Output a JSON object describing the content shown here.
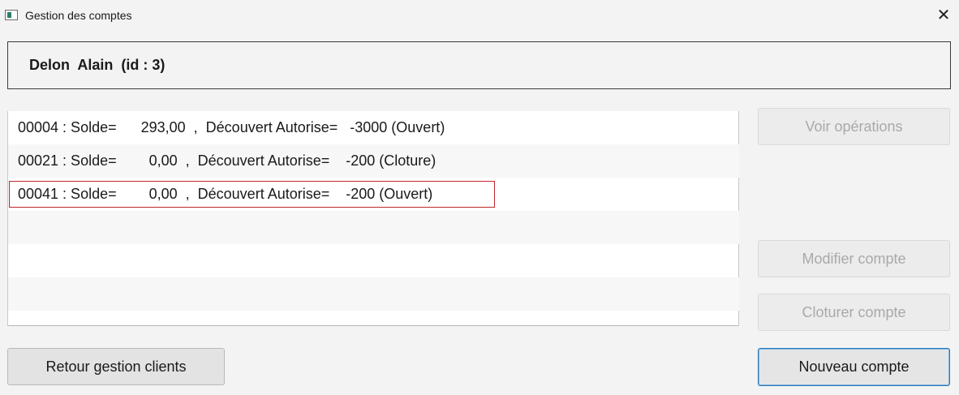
{
  "window": {
    "title": "Gestion des comptes",
    "close_glyph": "✕"
  },
  "header": {
    "client_label": "Delon  Alain  (id : 3)"
  },
  "accounts": [
    {
      "text": "00004 : Solde=      293,00  ,  Découvert Autorise=   -3000 (Ouvert)"
    },
    {
      "text": "00021 : Solde=        0,00  ,  Découvert Autorise=    -200 (Cloture)"
    },
    {
      "text": "00041 : Solde=        0,00  ,  Découvert Autorise=    -200 (Ouvert)"
    }
  ],
  "buttons": {
    "voir_operations": "Voir opérations",
    "modifier_compte": "Modifier compte",
    "cloturer_compte": "Cloturer compte",
    "nouveau_compte": "Nouveau compte",
    "retour_gestion_clients": "Retour gestion clients"
  },
  "colors": {
    "selection_outline": "#c1272d",
    "default_button_border": "#2b78b8"
  }
}
